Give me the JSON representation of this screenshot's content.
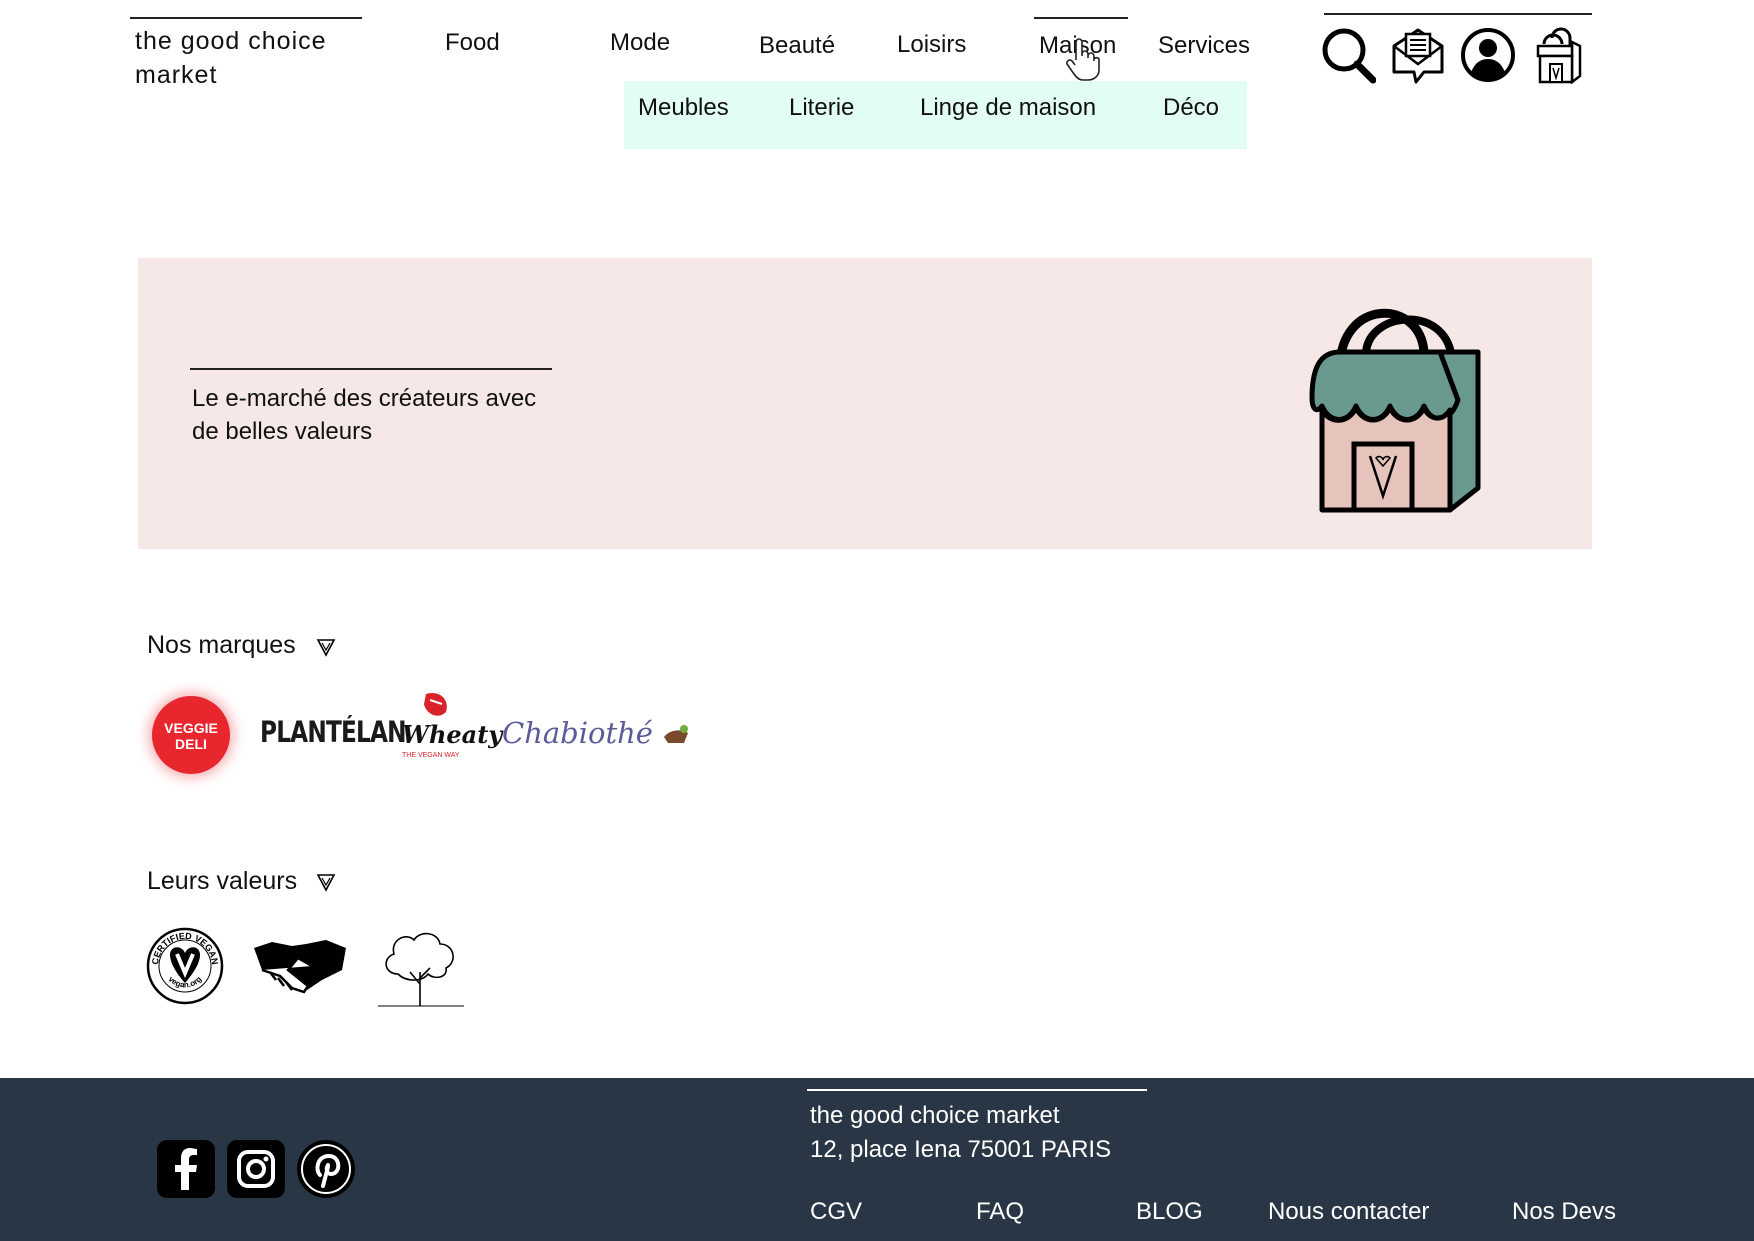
{
  "header": {
    "logo_line1": "the good choice",
    "logo_line2": "market",
    "nav": [
      "Food",
      "Mode",
      "Beauté",
      "Loisirs",
      "Maison",
      "Services"
    ],
    "active_nav": "Maison",
    "submenu": [
      "Meubles",
      "Literie",
      "Linge de maison",
      "Déco"
    ],
    "icons": [
      "search-icon",
      "message-icon",
      "account-icon",
      "shop-bag-icon"
    ]
  },
  "hero": {
    "tagline_line1": "Le e-marché des créateurs avec",
    "tagline_line2": "de belles valeurs",
    "background": "#f5e8e6"
  },
  "brands": {
    "title": "Nos marques",
    "items": [
      {
        "name": "veggie-deli-logo",
        "line1": "VEGGIE",
        "line2": "DELI",
        "color": "#e8262e"
      },
      {
        "name": "plantelan-logo",
        "text": "PLANTÉLAN"
      },
      {
        "name": "wheaty-logo",
        "text": "Wheaty",
        "sub": "THE VEGAN WAY",
        "color": "#d8232a"
      },
      {
        "name": "chabiothe-logo",
        "text": "Chabiothé",
        "color": "#5b5a9c"
      }
    ]
  },
  "values": {
    "title": "Leurs valeurs",
    "badge_top": "CERTIFIED VEGAN",
    "badge_bottom": "vegan.org",
    "items": [
      "certified-vegan-icon",
      "handshake-icon",
      "tree-icon"
    ]
  },
  "footer": {
    "name": "the good choice market",
    "address": "12, place Iena 75001 PARIS",
    "links": [
      "CGV",
      "FAQ",
      "BLOG",
      "Nous contacter",
      "Nos Devs"
    ],
    "socials": [
      "facebook-icon",
      "instagram-icon",
      "pinterest-icon"
    ],
    "background": "#283645"
  },
  "colors": {
    "submenu_bg": "#e2fdf2",
    "shop_teal": "#6a9a8f",
    "shop_pink": "#e6c4bb"
  }
}
